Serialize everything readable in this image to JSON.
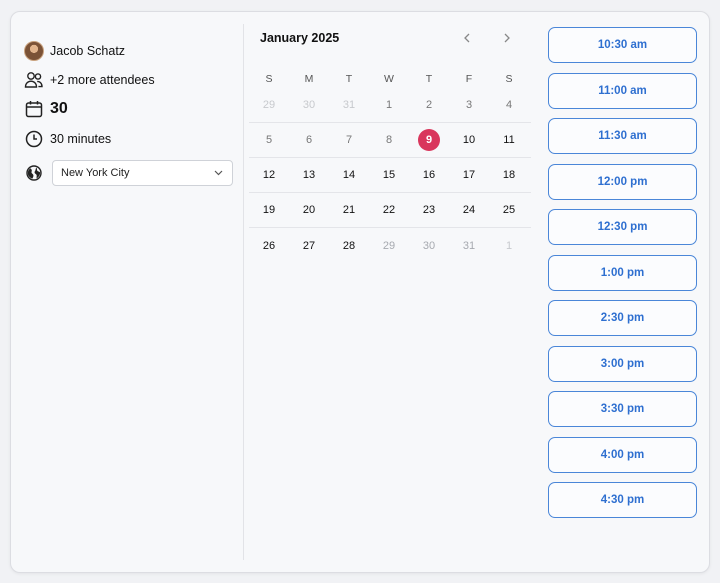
{
  "host": {
    "name": "Jacob Schatz"
  },
  "attendees": {
    "text": "+2 more attendees"
  },
  "date": {
    "text": "30"
  },
  "duration": {
    "text": "30 minutes"
  },
  "timezone": {
    "selected": "New York City"
  },
  "calendar": {
    "month_title": "January 2025",
    "weekdays": [
      "S",
      "M",
      "T",
      "W",
      "T",
      "F",
      "S"
    ],
    "weeks": [
      [
        {
          "d": "29",
          "s": "very-muted"
        },
        {
          "d": "30",
          "s": "very-muted"
        },
        {
          "d": "31",
          "s": "very-muted"
        },
        {
          "d": "1",
          "s": "mid"
        },
        {
          "d": "2",
          "s": "mid"
        },
        {
          "d": "3",
          "s": "mid"
        },
        {
          "d": "4",
          "s": "mid"
        }
      ],
      [
        {
          "d": "5",
          "s": "mid"
        },
        {
          "d": "6",
          "s": "mid"
        },
        {
          "d": "7",
          "s": "mid"
        },
        {
          "d": "8",
          "s": "mid"
        },
        {
          "d": "9",
          "s": "selected"
        },
        {
          "d": "10",
          "s": ""
        },
        {
          "d": "11",
          "s": ""
        }
      ],
      [
        {
          "d": "12",
          "s": ""
        },
        {
          "d": "13",
          "s": ""
        },
        {
          "d": "14",
          "s": ""
        },
        {
          "d": "15",
          "s": ""
        },
        {
          "d": "16",
          "s": ""
        },
        {
          "d": "17",
          "s": ""
        },
        {
          "d": "18",
          "s": ""
        }
      ],
      [
        {
          "d": "19",
          "s": ""
        },
        {
          "d": "20",
          "s": ""
        },
        {
          "d": "21",
          "s": ""
        },
        {
          "d": "22",
          "s": ""
        },
        {
          "d": "23",
          "s": ""
        },
        {
          "d": "24",
          "s": ""
        },
        {
          "d": "25",
          "s": ""
        }
      ],
      [
        {
          "d": "26",
          "s": ""
        },
        {
          "d": "27",
          "s": ""
        },
        {
          "d": "28",
          "s": ""
        },
        {
          "d": "29",
          "s": "muted"
        },
        {
          "d": "30",
          "s": "muted"
        },
        {
          "d": "31",
          "s": "muted"
        },
        {
          "d": "1",
          "s": "very-muted"
        }
      ]
    ],
    "selected_color": "#d9365c"
  },
  "time_slots": [
    "10:30 am",
    "11:00 am",
    "11:30 am",
    "12:00 pm",
    "12:30 pm",
    "1:00 pm",
    "2:30 pm",
    "3:00 pm",
    "3:30 pm",
    "4:00 pm",
    "4:30 pm"
  ],
  "accent_color": "#2e6fd0"
}
